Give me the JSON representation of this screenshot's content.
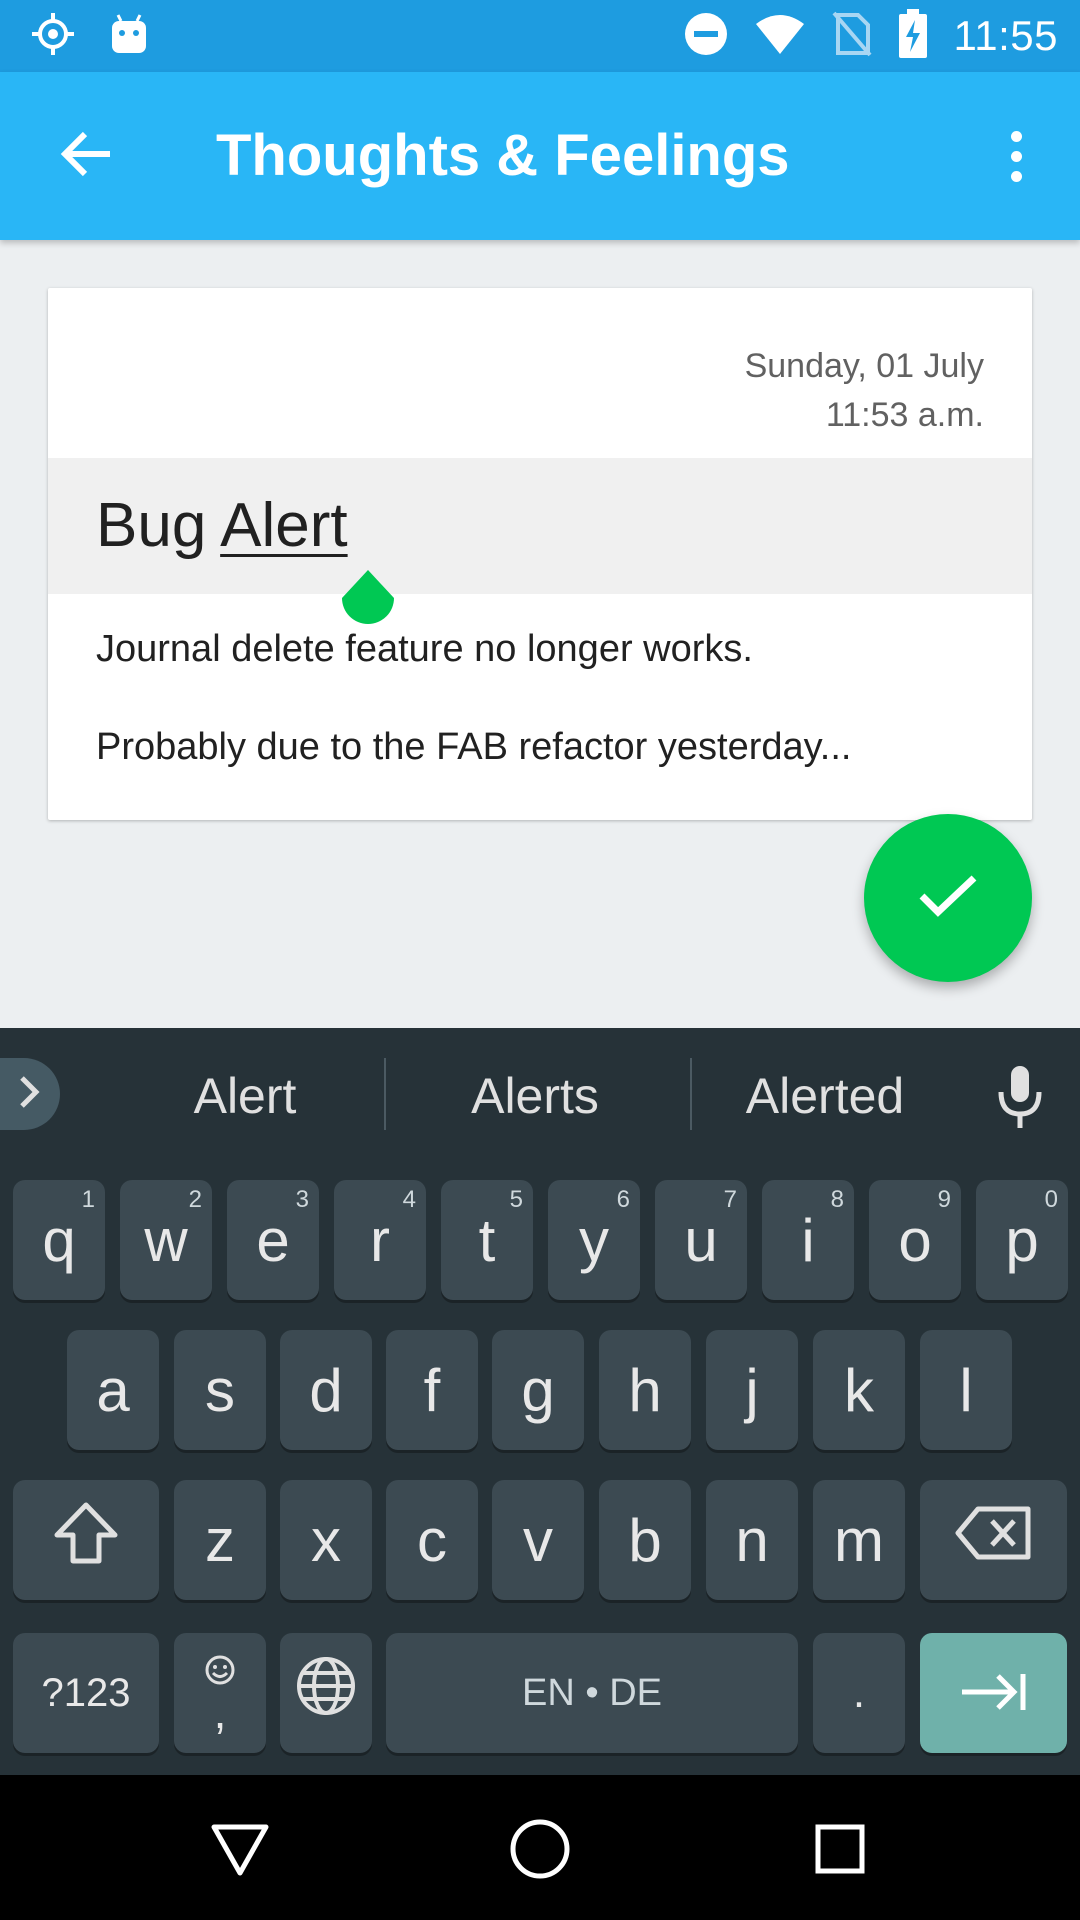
{
  "status_bar": {
    "time": "11:55",
    "icons": [
      "gps-icon",
      "android-icon",
      "do-not-disturb-icon",
      "wifi-icon",
      "no-sim-icon",
      "battery-charging-icon"
    ]
  },
  "app_bar": {
    "title": "Thoughts & Feelings",
    "back_icon": "arrow-back-icon",
    "more_icon": "more-vert-icon"
  },
  "entry": {
    "date": "Sunday, 01 July",
    "time": "11:53 a.m.",
    "title_word1": "Bug",
    "title_word2": "Alert",
    "body_line1": "Journal delete feature no longer works.",
    "body_line2": "Probably due to the FAB refactor yesterday..."
  },
  "fab": {
    "icon": "check-icon",
    "color": "#00c853"
  },
  "keyboard": {
    "suggestions": [
      "Alert",
      "Alerts",
      "Alerted"
    ],
    "row1": [
      {
        "label": "q",
        "hint": "1"
      },
      {
        "label": "w",
        "hint": "2"
      },
      {
        "label": "e",
        "hint": "3"
      },
      {
        "label": "r",
        "hint": "4"
      },
      {
        "label": "t",
        "hint": "5"
      },
      {
        "label": "y",
        "hint": "6"
      },
      {
        "label": "u",
        "hint": "7"
      },
      {
        "label": "i",
        "hint": "8"
      },
      {
        "label": "o",
        "hint": "9"
      },
      {
        "label": "p",
        "hint": "0"
      }
    ],
    "row2": [
      "a",
      "s",
      "d",
      "f",
      "g",
      "h",
      "j",
      "k",
      "l"
    ],
    "row3": [
      "z",
      "x",
      "c",
      "v",
      "b",
      "n",
      "m"
    ],
    "symbols_label": "?123",
    "comma_label": ",",
    "space_label": "EN • DE",
    "period_label": ".",
    "enter_color": "#6fb1aa"
  },
  "nav_bar": {
    "icons": [
      "back-triangle-icon",
      "home-circle-icon",
      "recents-square-icon"
    ]
  }
}
